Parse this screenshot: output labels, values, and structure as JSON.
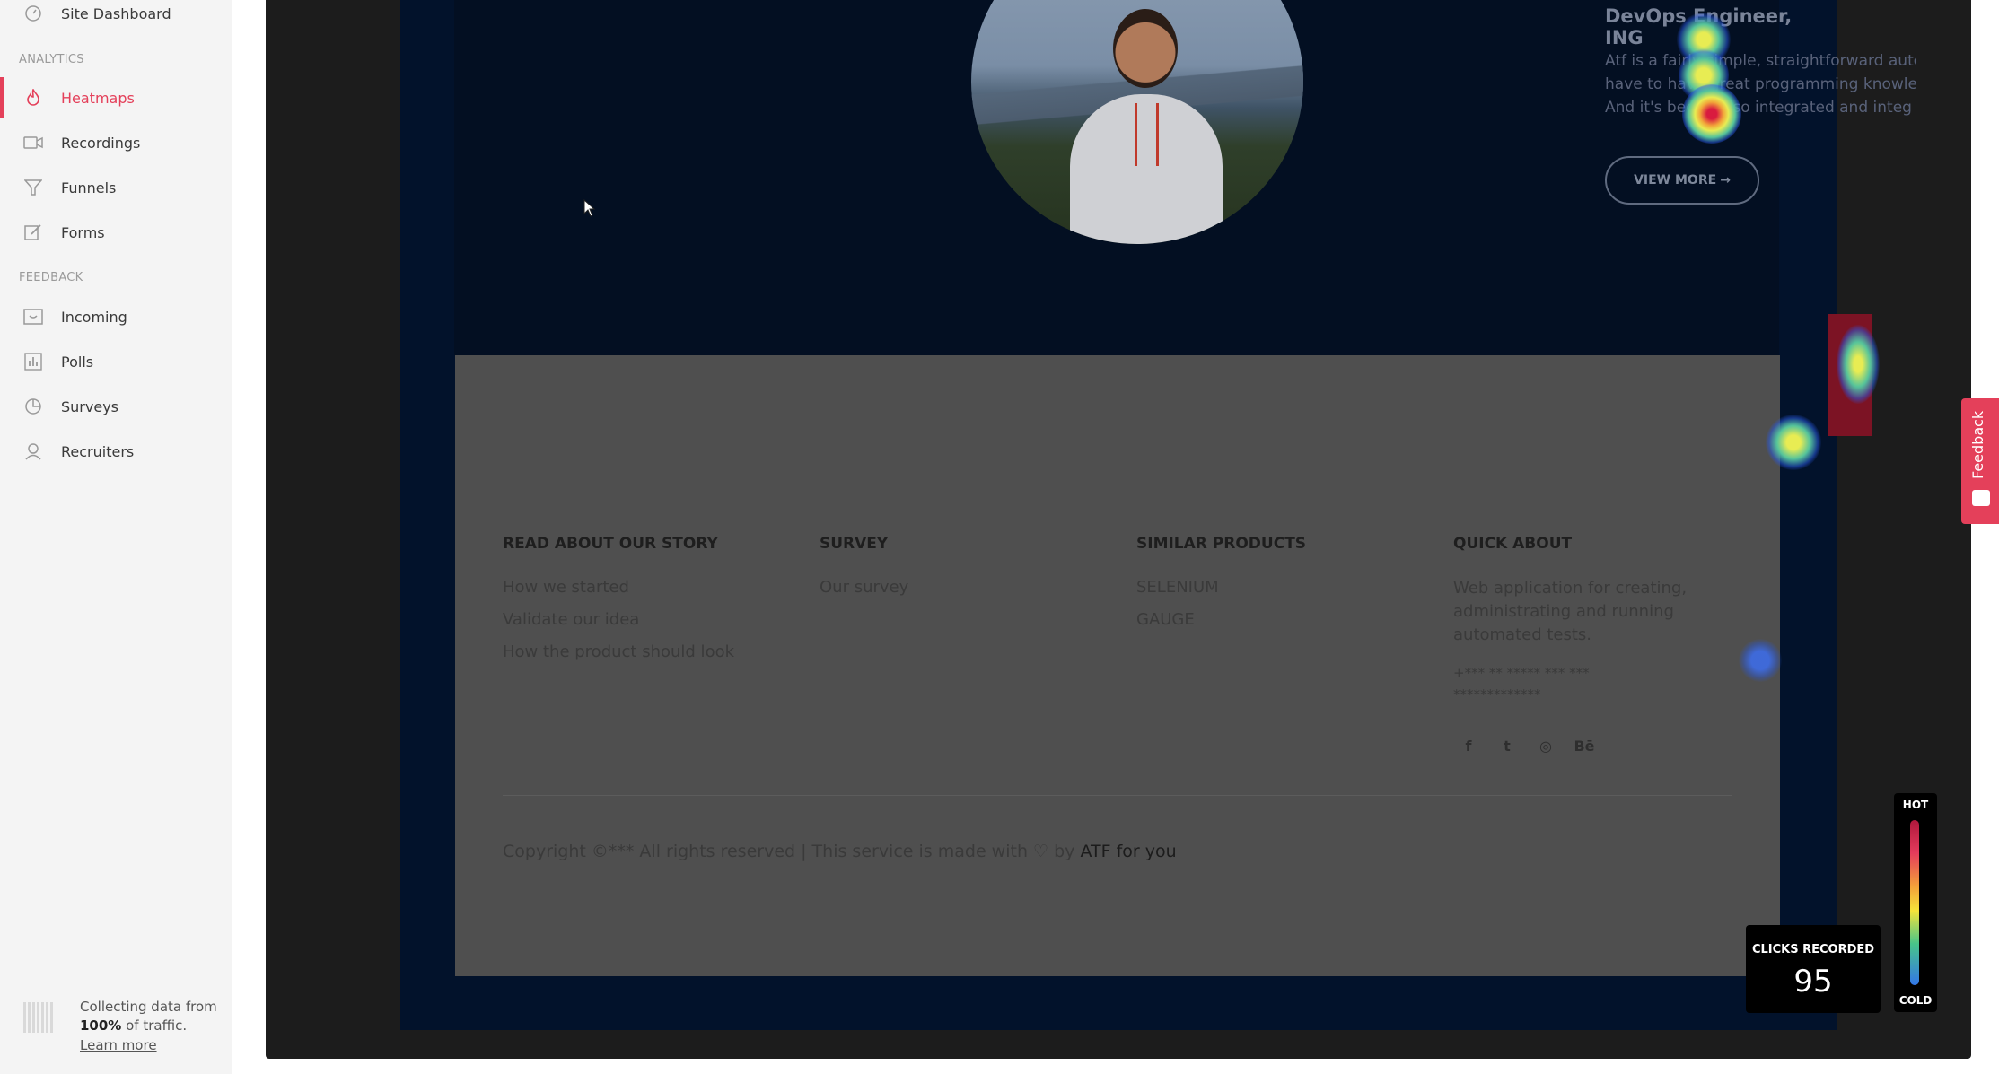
{
  "sidebar": {
    "top_item": "Site Dashboard",
    "sections": {
      "analytics": "ANALYTICS",
      "feedback": "FEEDBACK"
    },
    "items": [
      {
        "label": "Heatmaps",
        "icon": "flame-icon",
        "active": true
      },
      {
        "label": "Recordings",
        "icon": "video-icon"
      },
      {
        "label": "Funnels",
        "icon": "funnel-icon"
      },
      {
        "label": "Forms",
        "icon": "edit-icon"
      },
      {
        "label": "Incoming",
        "icon": "inbox-icon"
      },
      {
        "label": "Polls",
        "icon": "bar-chart-icon"
      },
      {
        "label": "Surveys",
        "icon": "pie-chart-icon"
      },
      {
        "label": "Recruiters",
        "icon": "user-icon"
      }
    ],
    "collecting": {
      "text_before": "Collecting data from",
      "percent": "100%",
      "text_after": "of traffic.",
      "learn_more": "Learn more"
    }
  },
  "site": {
    "job_title": "DevOps Engineer, ING",
    "job_lines": [
      "Atf is a fairly simple, straightforward auto",
      "have to have great programming knowle",
      "And it's become so integrated and integ"
    ],
    "view_more": "VIEW MORE",
    "footer": {
      "columns": [
        {
          "heading": "READ ABOUT OUR STORY",
          "links": [
            "How we started",
            "Validate our idea",
            "How the product should look"
          ]
        },
        {
          "heading": "SURVEY",
          "links": [
            "Our survey"
          ]
        },
        {
          "heading": "SIMILAR PRODUCTS",
          "links": [
            "SELENIUM",
            "GAUGE"
          ]
        },
        {
          "heading": "QUICK ABOUT",
          "text": [
            "Web application for creating,",
            "administrating and running",
            "automated tests."
          ],
          "contact": [
            "+*** ** ***** *** ***",
            "*************"
          ]
        }
      ],
      "social": [
        "f",
        "t",
        "◎",
        "Bē"
      ],
      "copyright": {
        "prefix": "Copyright ©*** All rights reserved | This service is made with",
        "by": "by",
        "brand": "ATF for you"
      }
    }
  },
  "clicks": {
    "label": "CLICKS RECORDED",
    "value": "95"
  },
  "legend": {
    "hot": "HOT",
    "cold": "COLD"
  },
  "feedback_tab": "Feedback",
  "colors": {
    "accent": "#e4405a",
    "site_bg": "#02122b",
    "footer_bg": "#4f4f4f"
  }
}
